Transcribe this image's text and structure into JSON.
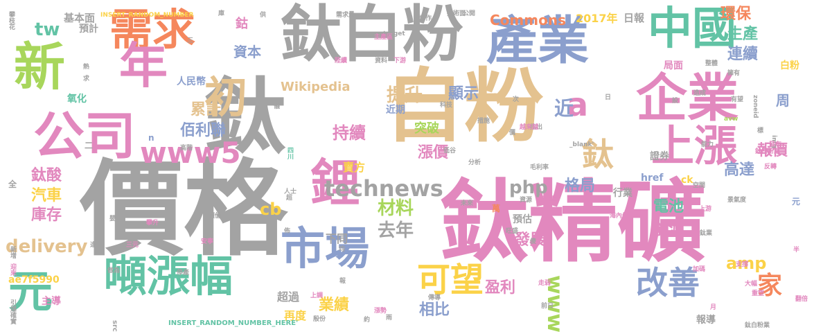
{
  "palette": {
    "gray": "#a3a3a3",
    "green": "#62c3a5",
    "orange": "#f5875d",
    "blue": "#8b9fcd",
    "pink": "#e288be",
    "lime": "#a8d65b",
    "yellow": "#fbd248",
    "tan": "#e4c28f"
  },
  "words": [
    {
      "text": "價格",
      "color": "gray"
    },
    {
      "text": "鈦精礦",
      "color": "pink"
    },
    {
      "text": "自粉",
      "color": "tan"
    },
    {
      "text": "鈦白粉",
      "color": "gray"
    },
    {
      "text": "鈦",
      "color": "gray"
    },
    {
      "text": "企業",
      "color": "pink"
    },
    {
      "text": "產業",
      "color": "blue"
    },
    {
      "text": "公司",
      "color": "pink"
    },
    {
      "text": "新",
      "color": "lime"
    },
    {
      "text": "中國",
      "color": "green"
    },
    {
      "text": "需求",
      "color": "orange"
    },
    {
      "text": "年",
      "color": "pink"
    },
    {
      "text": "噸漲幅",
      "color": "green"
    },
    {
      "text": "市場",
      "color": "blue"
    },
    {
      "text": "上漲",
      "color": "pink"
    },
    {
      "text": "元",
      "color": "green"
    },
    {
      "text": "初",
      "color": "tan"
    },
    {
      "text": "www5",
      "color": "pink"
    },
    {
      "text": "可望",
      "color": "yellow"
    },
    {
      "text": "改善",
      "color": "blue"
    },
    {
      "text": "鋰",
      "color": "pink"
    },
    {
      "text": "technews",
      "color": "gray"
    },
    {
      "text": "鈦",
      "color": "tan"
    },
    {
      "text": "a",
      "color": "pink"
    },
    {
      "text": "家",
      "color": "orange"
    },
    {
      "text": "tw",
      "color": "green"
    },
    {
      "text": "www",
      "color": "lime"
    },
    {
      "text": "去年",
      "color": "gray"
    },
    {
      "text": "材料",
      "color": "lime"
    },
    {
      "text": "php",
      "color": "gray"
    },
    {
      "text": "cb",
      "color": "yellow"
    },
    {
      "text": "delivery",
      "color": "tan"
    },
    {
      "text": "amp",
      "color": "yellow"
    },
    {
      "text": "持續",
      "color": "pink"
    },
    {
      "text": "提升",
      "color": "tan"
    },
    {
      "text": "漲價",
      "color": "pink"
    },
    {
      "text": "顯示",
      "color": "blue"
    },
    {
      "text": "盈利",
      "color": "pink"
    },
    {
      "text": "業績",
      "color": "yellow"
    },
    {
      "text": "相比",
      "color": "blue"
    },
    {
      "text": "發展",
      "color": "pink"
    },
    {
      "text": "格局",
      "color": "blue"
    },
    {
      "text": "能源",
      "color": "pink"
    },
    {
      "text": "電池",
      "color": "green"
    },
    {
      "text": "高達",
      "color": "blue"
    },
    {
      "text": "報價",
      "color": "pink"
    },
    {
      "text": "環保",
      "color": "orange"
    },
    {
      "text": "生產",
      "color": "green"
    },
    {
      "text": "連續",
      "color": "blue"
    },
    {
      "text": "累計",
      "color": "tan"
    },
    {
      "text": "佰利聯",
      "color": "blue"
    },
    {
      "text": "鈦酸",
      "color": "pink"
    },
    {
      "text": "汽車",
      "color": "yellow"
    },
    {
      "text": "庫存",
      "color": "pink"
    },
    {
      "text": "Commons",
      "color": "orange"
    },
    {
      "text": "Wikipedia",
      "color": "tan"
    },
    {
      "text": "資本",
      "color": "blue"
    },
    {
      "text": "鈷",
      "color": "pink"
    },
    {
      "text": "近",
      "color": "blue"
    },
    {
      "text": "周",
      "color": "blue"
    },
    {
      "text": "突破",
      "color": "lime"
    },
    {
      "text": "2017年",
      "color": "yellow"
    },
    {
      "text": "日報",
      "color": "gray"
    },
    {
      "text": "基本面",
      "color": "gray"
    },
    {
      "text": "ae7f5990",
      "color": "yellow"
    },
    {
      "text": "主導",
      "color": "pink"
    },
    {
      "text": "超過",
      "color": "gray"
    },
    {
      "text": "再度",
      "color": "yellow"
    },
    {
      "text": "下同",
      "color": "gray"
    },
    {
      "text": "賣方",
      "color": "yellow"
    },
    {
      "text": "預估",
      "color": "gray"
    },
    {
      "text": "提高",
      "color": "pink"
    },
    {
      "text": "證券",
      "color": "gray"
    },
    {
      "text": "局面",
      "color": "pink"
    },
    {
      "text": "白粉",
      "color": "yellow"
    },
    {
      "text": "人民幣",
      "color": "blue"
    },
    {
      "text": "氧化",
      "color": "green"
    },
    {
      "text": "預計",
      "color": "gray"
    },
    {
      "text": "近期",
      "color": "blue"
    },
    {
      "text": "href",
      "color": "blue"
    },
    {
      "text": "行業",
      "color": "gray"
    },
    {
      "text": "ck",
      "color": "yellow"
    },
    {
      "text": "報導",
      "color": "gray"
    },
    {
      "text": "INSERT_RANDOM_NUMBER_HERE'",
      "color": "green"
    },
    {
      "text": "INSERT_RANDOM_NUMBER",
      "color": "yellow"
    },
    {
      "text": "_blank'",
      "color": "gray"
    },
    {
      "text": "target",
      "color": "gray"
    },
    {
      "text": "元",
      "color": "blue"
    },
    {
      "text": "萬",
      "color": "orange"
    },
    {
      "text": "二",
      "color": "gray"
    },
    {
      "text": "n",
      "color": "blue"
    },
    {
      "text": "全",
      "color": "gray"
    },
    {
      "text": "src",
      "color": "gray"
    },
    {
      "text": "四川",
      "color": "green"
    },
    {
      "text": "img",
      "color": "gray"
    },
    {
      "text": "zoneid",
      "color": "gray"
    },
    {
      "text": "avw",
      "color": "lime"
    },
    {
      "text": "需求量",
      "color": "gray"
    },
    {
      "text": "陸續",
      "color": "pink"
    },
    {
      "text": "主產區",
      "color": "pink"
    },
    {
      "text": "公開",
      "color": "gray"
    },
    {
      "text": "技術面",
      "color": "gray"
    },
    {
      "text": "炒作",
      "color": "gray"
    },
    {
      "text": "供",
      "color": "gray"
    },
    {
      "text": "攀枝花",
      "color": "gray"
    },
    {
      "text": "迎來",
      "color": "pink"
    },
    {
      "text": "引爆",
      "color": "gray"
    },
    {
      "text": "確實",
      "color": "gray"
    },
    {
      "text": "新增",
      "color": "gray"
    },
    {
      "text": "熱",
      "color": "gray"
    },
    {
      "text": "求",
      "color": "gray"
    },
    {
      "text": "資料",
      "color": "gray"
    },
    {
      "text": "下游",
      "color": "pink"
    },
    {
      "text": "指出",
      "color": "gray"
    },
    {
      "text": "毛利率",
      "color": "gray"
    },
    {
      "text": "安寧",
      "color": "pink"
    },
    {
      "text": "停產",
      "color": "gray"
    },
    {
      "text": "分析",
      "color": "gray"
    },
    {
      "text": "大幅",
      "color": "pink"
    },
    {
      "text": "重塑",
      "color": "pink"
    },
    {
      "text": "翻倍",
      "color": "pink"
    },
    {
      "text": "半",
      "color": "pink"
    },
    {
      "text": "支撐",
      "color": "pink"
    },
    {
      "text": "鈦白粉業",
      "color": "gray"
    },
    {
      "text": "傳導",
      "color": "gray"
    },
    {
      "text": "走弱",
      "color": "pink"
    },
    {
      "text": "前日",
      "color": "gray"
    },
    {
      "text": "漲勢",
      "color": "pink"
    },
    {
      "text": "加碼",
      "color": "pink"
    },
    {
      "text": "空間",
      "color": "gray"
    },
    {
      "text": "上游",
      "color": "pink"
    },
    {
      "text": "能力",
      "color": "gray"
    },
    {
      "text": "發布",
      "color": "pink"
    },
    {
      "text": "有望",
      "color": "gray"
    },
    {
      "text": "擁有",
      "color": "gray"
    },
    {
      "text": "整體",
      "color": "gray"
    },
    {
      "text": "造成",
      "color": "gray"
    },
    {
      "text": "科技",
      "color": "gray"
    },
    {
      "text": "低谷",
      "color": "gray"
    },
    {
      "text": "措施",
      "color": "gray"
    },
    {
      "text": "越來越",
      "color": "pink"
    },
    {
      "text": "攀升",
      "color": "pink"
    },
    {
      "text": "三元",
      "color": "pink"
    },
    {
      "text": "做為",
      "color": "gray"
    },
    {
      "text": "價值",
      "color": "gray"
    },
    {
      "text": "人士",
      "color": "gray"
    },
    {
      "text": "上調",
      "color": "pink"
    },
    {
      "text": "高階",
      "color": "gray"
    },
    {
      "text": "價",
      "color": "gray"
    },
    {
      "text": "旺盛",
      "color": "gray"
    },
    {
      "text": "資源",
      "color": "gray"
    },
    {
      "text": "未來",
      "color": "gray"
    },
    {
      "text": "次",
      "color": "gray"
    },
    {
      "text": "海內外",
      "color": "pink"
    },
    {
      "text": "景氣度",
      "color": "gray"
    },
    {
      "text": "反轉",
      "color": "pink"
    },
    {
      "text": "鈦業",
      "color": "gray"
    },
    {
      "text": "鈦白粉業",
      "color": "pink"
    },
    {
      "text": "月",
      "color": "pink"
    },
    {
      "text": "殷份",
      "color": "gray"
    },
    {
      "text": "約",
      "color": "gray"
    },
    {
      "text": "報",
      "color": "gray"
    },
    {
      "text": "均",
      "color": "gray"
    },
    {
      "text": "雨",
      "color": "gray"
    },
    {
      "text": "庫",
      "color": "gray"
    },
    {
      "text": "三",
      "color": "gray"
    },
    {
      "text": "日",
      "color": "gray"
    },
    {
      "text": "標",
      "color": "gray"
    },
    {
      "text": "設",
      "color": "gray"
    },
    {
      "text": "超",
      "color": "gray"
    },
    {
      "text": "傻",
      "color": "gray"
    },
    {
      "text": "逢",
      "color": "gray"
    },
    {
      "text": "嬰",
      "color": "gray"
    },
    {
      "text": "儀",
      "color": "gray"
    },
    {
      "text": "佈",
      "color": "gray"
    }
  ]
}
